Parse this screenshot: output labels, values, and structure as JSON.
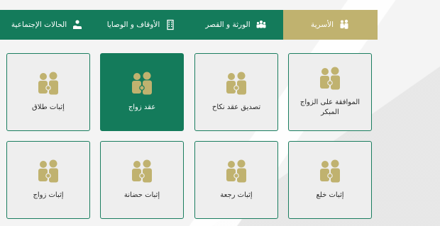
{
  "nav": {
    "tabs": [
      {
        "label": "الأسرية",
        "icon": "family-icon",
        "active": true
      },
      {
        "label": "الورثة و القصر",
        "icon": "group-icon",
        "active": false
      },
      {
        "label": "الأوقاف و الوصايا",
        "icon": "building-icon",
        "active": false
      },
      {
        "label": "الحالات الإجتماعية",
        "icon": "hand-coin-icon",
        "active": false
      }
    ]
  },
  "services": {
    "row1": [
      {
        "label": "الموافقة على الزواج المبكر",
        "icon": "family-icon"
      },
      {
        "label": "تصديق عقد نكاح",
        "icon": "family-icon"
      },
      {
        "label": "عقد زواج",
        "icon": "family-icon",
        "selected": true
      },
      {
        "label": "إثبات طلاق",
        "icon": "family-icon"
      }
    ],
    "row2": [
      {
        "label": "إثبات خلع",
        "icon": "family-icon"
      },
      {
        "label": "إثبات رجعة",
        "icon": "family-icon"
      },
      {
        "label": "إثبات حضانة",
        "icon": "family-icon"
      },
      {
        "label": "إثبات زواج",
        "icon": "family-icon"
      }
    ]
  },
  "colors": {
    "primary_green": "#147b5b",
    "gold": "#c0b26f",
    "card_bg": "#eeeeee"
  }
}
